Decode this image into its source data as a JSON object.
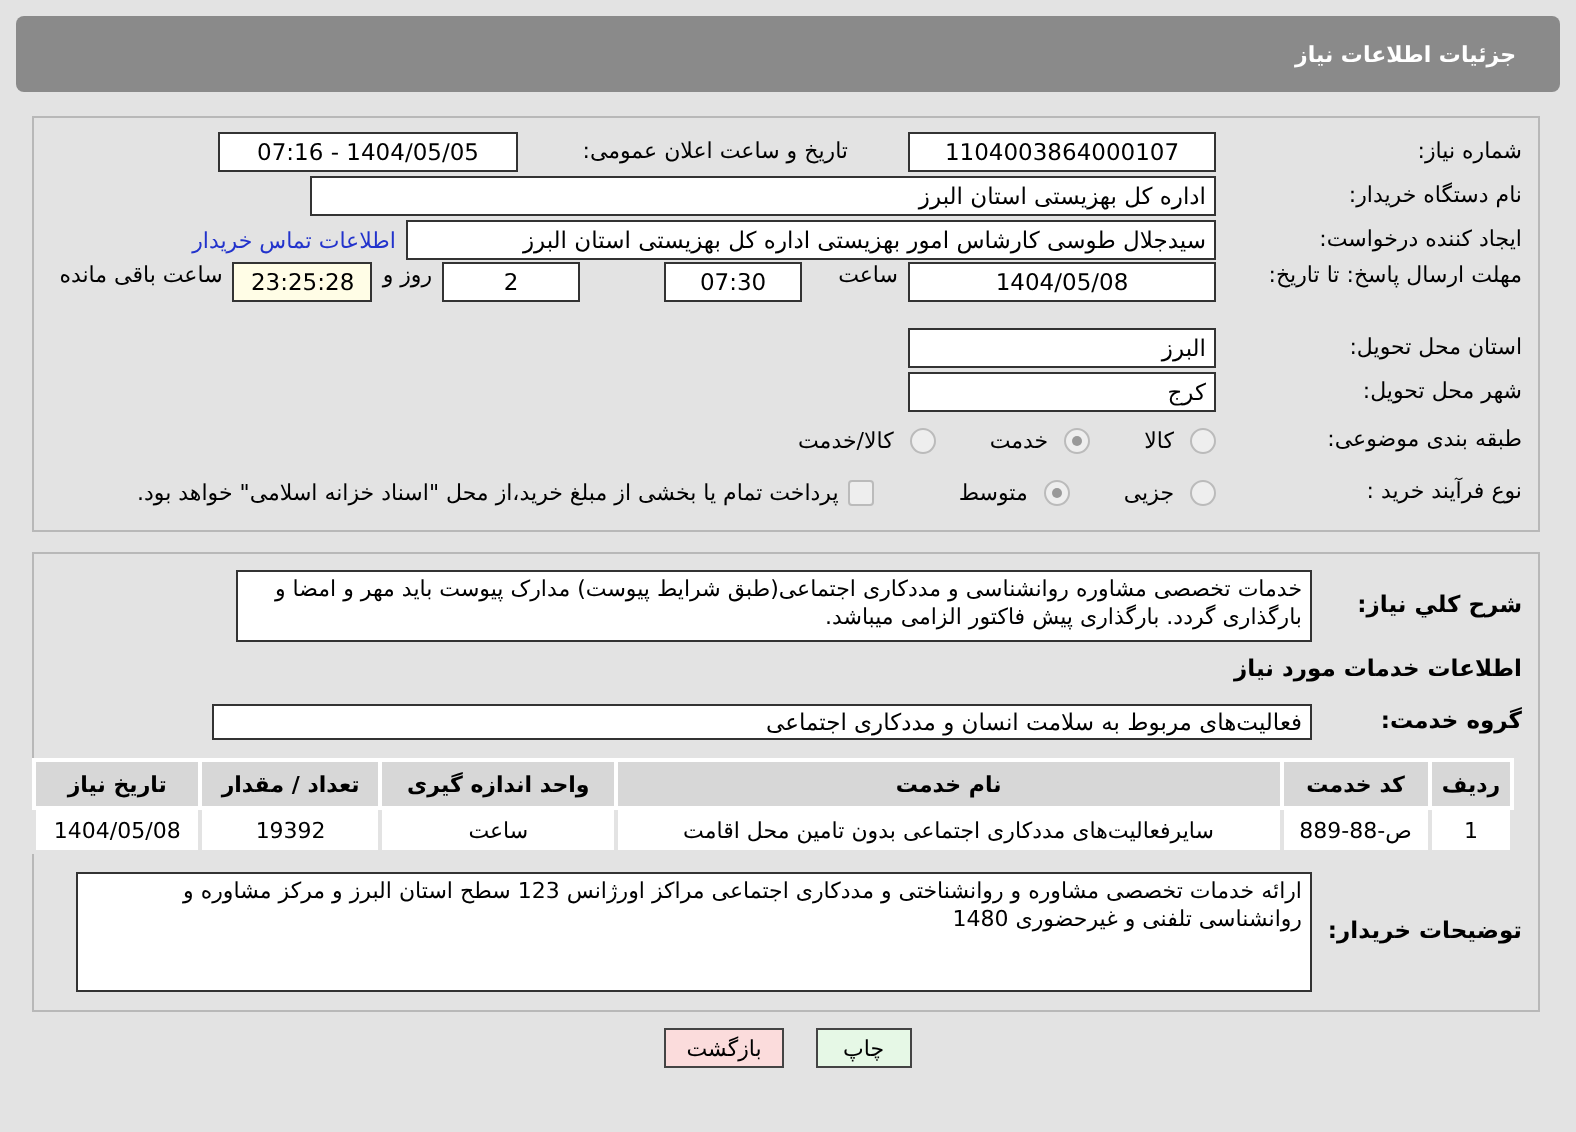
{
  "header": {
    "title": "جزئیات اطلاعات نیاز"
  },
  "need_number": {
    "label": "شماره نیاز:",
    "value": "1104003864000107"
  },
  "announce": {
    "label": "تاریخ و ساعت اعلان عمومی:",
    "value": "1404/05/05 - 07:16"
  },
  "buyer": {
    "label": "نام دستگاه خریدار:",
    "value": "اداره کل بهزیستی استان البرز"
  },
  "creator": {
    "label": "ایجاد کننده درخواست:",
    "value": "سیدجلال طوسی کارشاس امور بهزیستی اداره کل بهزیستی استان البرز",
    "link": "اطلاعات تماس خریدار"
  },
  "deadline": {
    "label": "مهلت ارسال پاسخ: تا تاریخ:",
    "date": "1404/05/08",
    "time_label": "ساعت",
    "time": "07:30",
    "days": "2",
    "days_label": "روز و",
    "remaining": "23:25:28",
    "remaining_label": "ساعت باقی مانده"
  },
  "province": {
    "label": "استان محل تحویل:",
    "value": "البرز"
  },
  "city": {
    "label": "شهر محل تحویل:",
    "value": "کرج"
  },
  "category": {
    "label": "طبقه بندی موضوعی:",
    "options": [
      {
        "label": "کالا",
        "selected": false
      },
      {
        "label": "خدمت",
        "selected": true
      },
      {
        "label": "کالا/خدمت",
        "selected": false
      }
    ]
  },
  "process": {
    "label": "نوع فرآیند خرید :",
    "options": [
      {
        "label": "جزیی",
        "selected": false
      },
      {
        "label": "متوسط",
        "selected": true
      }
    ],
    "payment": {
      "label": "پرداخت تمام یا بخشی از مبلغ خرید،از محل \"اسناد خزانه اسلامی\" خواهد بود.",
      "checked": false
    }
  },
  "description": {
    "label": "شرح کلي نياز:",
    "value": "خدمات تخصصی مشاوره روانشناسی و مددکاری اجتماعی(طبق شرایط پیوست) مدارک پیوست باید مهر و امضا و بارگذاری گردد. بارگذاری پیش فاکتور الزامی میباشد."
  },
  "services_heading": "اطلاعات خدمات مورد نیاز",
  "service_group": {
    "label": "گروه خدمت:",
    "value": "فعالیت‌های مربوط به سلامت انسان و مددکاری اجتماعی"
  },
  "table": {
    "columns": [
      "ردیف",
      "کد خدمت",
      "نام خدمت",
      "واحد اندازه گیری",
      "تعداد / مقدار",
      "تاریخ نیاز"
    ],
    "rows": [
      [
        "1",
        "ص-88-889",
        "سایرفعالیت‌های مددکاری اجتماعی بدون تامین محل اقامت",
        "ساعت",
        "19392",
        "1404/05/08"
      ]
    ]
  },
  "notes": {
    "label": "توضیحات خریدار:",
    "value": "ارائه خدمات تخصصی مشاوره و روانشناختی و مددکاری اجتماعی  مراکز اورژانس 123 سطح استان البرز و مرکز مشاوره و روانشناسی تلفنی و غیرحضوری 1480"
  },
  "buttons": [
    {
      "label": "چاپ",
      "kind": "print"
    },
    {
      "label": "بازگشت",
      "kind": "back"
    }
  ]
}
